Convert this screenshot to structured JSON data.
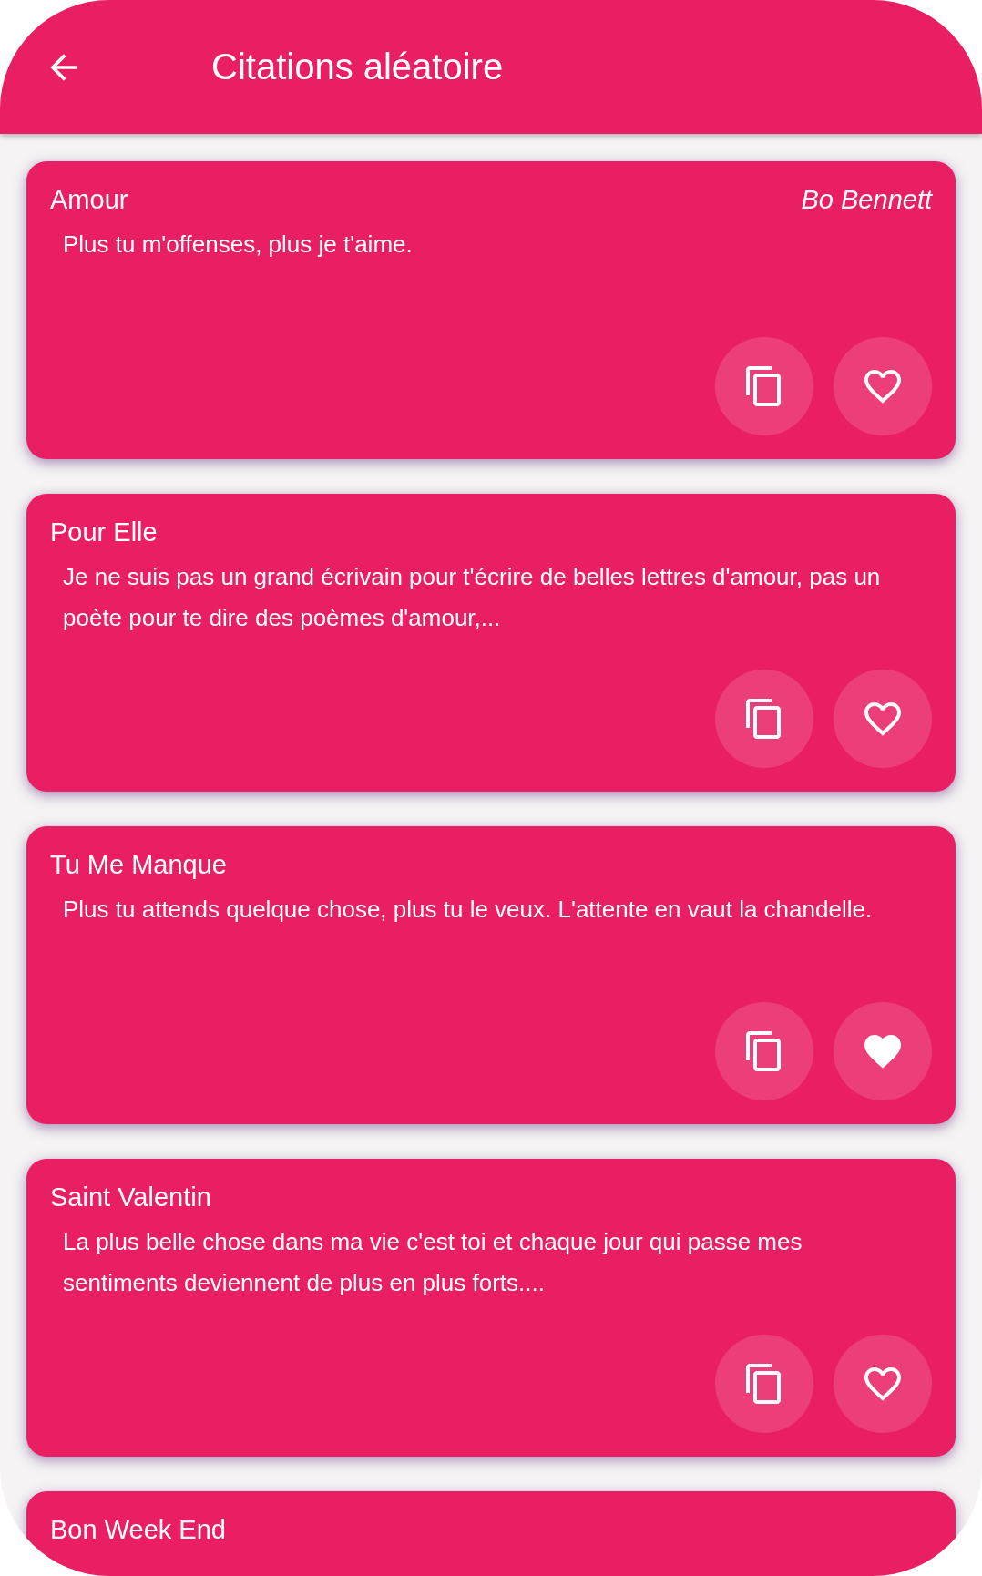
{
  "app_bar": {
    "title": "Citations aléatoire"
  },
  "quotes": [
    {
      "category": "Amour",
      "author": "Bo Bennett",
      "text": "Plus tu m'offenses, plus je t'aime.",
      "favorite": false
    },
    {
      "category": "Pour Elle",
      "text": "Je ne suis pas un grand écrivain pour t'écrire de belles lettres d'amour, pas un poète pour te dire des poèmes d'amour,...",
      "favorite": false
    },
    {
      "category": "Tu Me Manque",
      "text": "Plus tu attends quelque chose, plus tu le veux. L'attente en vaut la chandelle.",
      "favorite": true
    },
    {
      "category": "Saint Valentin",
      "text": "La plus belle chose dans ma vie c'est toi et chaque jour qui passe mes sentiments deviennent de plus en plus forts....",
      "favorite": false
    },
    {
      "category": "Bon Week End"
    }
  ]
}
